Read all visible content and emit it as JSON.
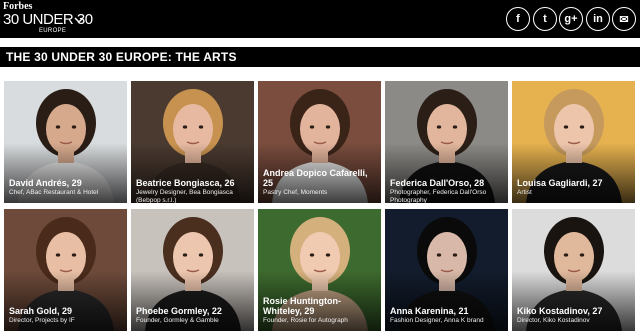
{
  "header": {
    "brand": "Forbes",
    "title": "30 UNDER 30",
    "region": "EUROPE",
    "social": [
      {
        "name": "facebook-icon",
        "glyph": "f"
      },
      {
        "name": "twitter-icon",
        "glyph": "t"
      },
      {
        "name": "google-plus-icon",
        "glyph": "g+"
      },
      {
        "name": "linkedin-icon",
        "glyph": "in"
      },
      {
        "name": "email-icon",
        "glyph": "✉"
      }
    ]
  },
  "section": {
    "title": "THE 30 UNDER 30 EUROPE: THE ARTS"
  },
  "people": [
    {
      "name": "David Andrés, 29",
      "role": "Chef, ABac Restaurant & Hotel",
      "bg": "#d9dcde",
      "skin": "#d6a98c",
      "hair": "#2a1d16",
      "shirt": "#f2f2f2"
    },
    {
      "name": "Beatrice Bongiasca, 26",
      "role": "Jewelry Designer, Bea Bongiasca (Bebpop s.r.l.)",
      "bg": "#4a3a30",
      "skin": "#e7b9a0",
      "hair": "#c7924f",
      "shirt": "#3a2c24"
    },
    {
      "name": "Andrea Dopico Cafarelli, 25",
      "role": "Pastry Chef, Moments",
      "bg": "#7a4d3e",
      "skin": "#e3b49c",
      "hair": "#3a2418",
      "shirt": "#f0f0f0"
    },
    {
      "name": "Federica Dall'Orso, 28",
      "role": "Photographer, Federica Dall'Orso Photography",
      "bg": "#8c8a86",
      "skin": "#e1b69d",
      "hair": "#2a1e16",
      "shirt": "#111111"
    },
    {
      "name": "Louisa Gagliardi, 27",
      "role": "Artist",
      "bg": "#e6b24f",
      "skin": "#edc5ab",
      "hair": "#c59a5c",
      "shirt": "#1a1a1a"
    },
    {
      "name": "Sarah Gold, 29",
      "role": "Director, Projects by IF",
      "bg": "#6e4a3a",
      "skin": "#e8bfa5",
      "hair": "#4a2a1a",
      "shirt": "#2a2a2a"
    },
    {
      "name": "Phoebe Gormley, 22",
      "role": "Founder, Gormley & Gamble",
      "bg": "#c8c2bc",
      "skin": "#ecc6ae",
      "hair": "#4a2e1e",
      "shirt": "#1d1d1d"
    },
    {
      "name": "Rosie Huntington-Whiteley, 29",
      "role": "Founder, Rosie for Autograph",
      "bg": "#3d6a2e",
      "skin": "#f0cbb2",
      "hair": "#d4b07c",
      "shirt": "#c8a888"
    },
    {
      "name": "Anna Karenina, 21",
      "role": "Fashion Designer, Anna K brand",
      "bg": "#121c2c",
      "skin": "#d8b8a8",
      "hair": "#0a0a0a",
      "shirt": "#101010"
    },
    {
      "name": "Kiko Kostadinov, 27",
      "role": "Director, Kiko Kostadinov",
      "bg": "#dcdcdc",
      "skin": "#e0b89c",
      "hair": "#1a1410",
      "shirt": "#2a2a2a"
    }
  ]
}
